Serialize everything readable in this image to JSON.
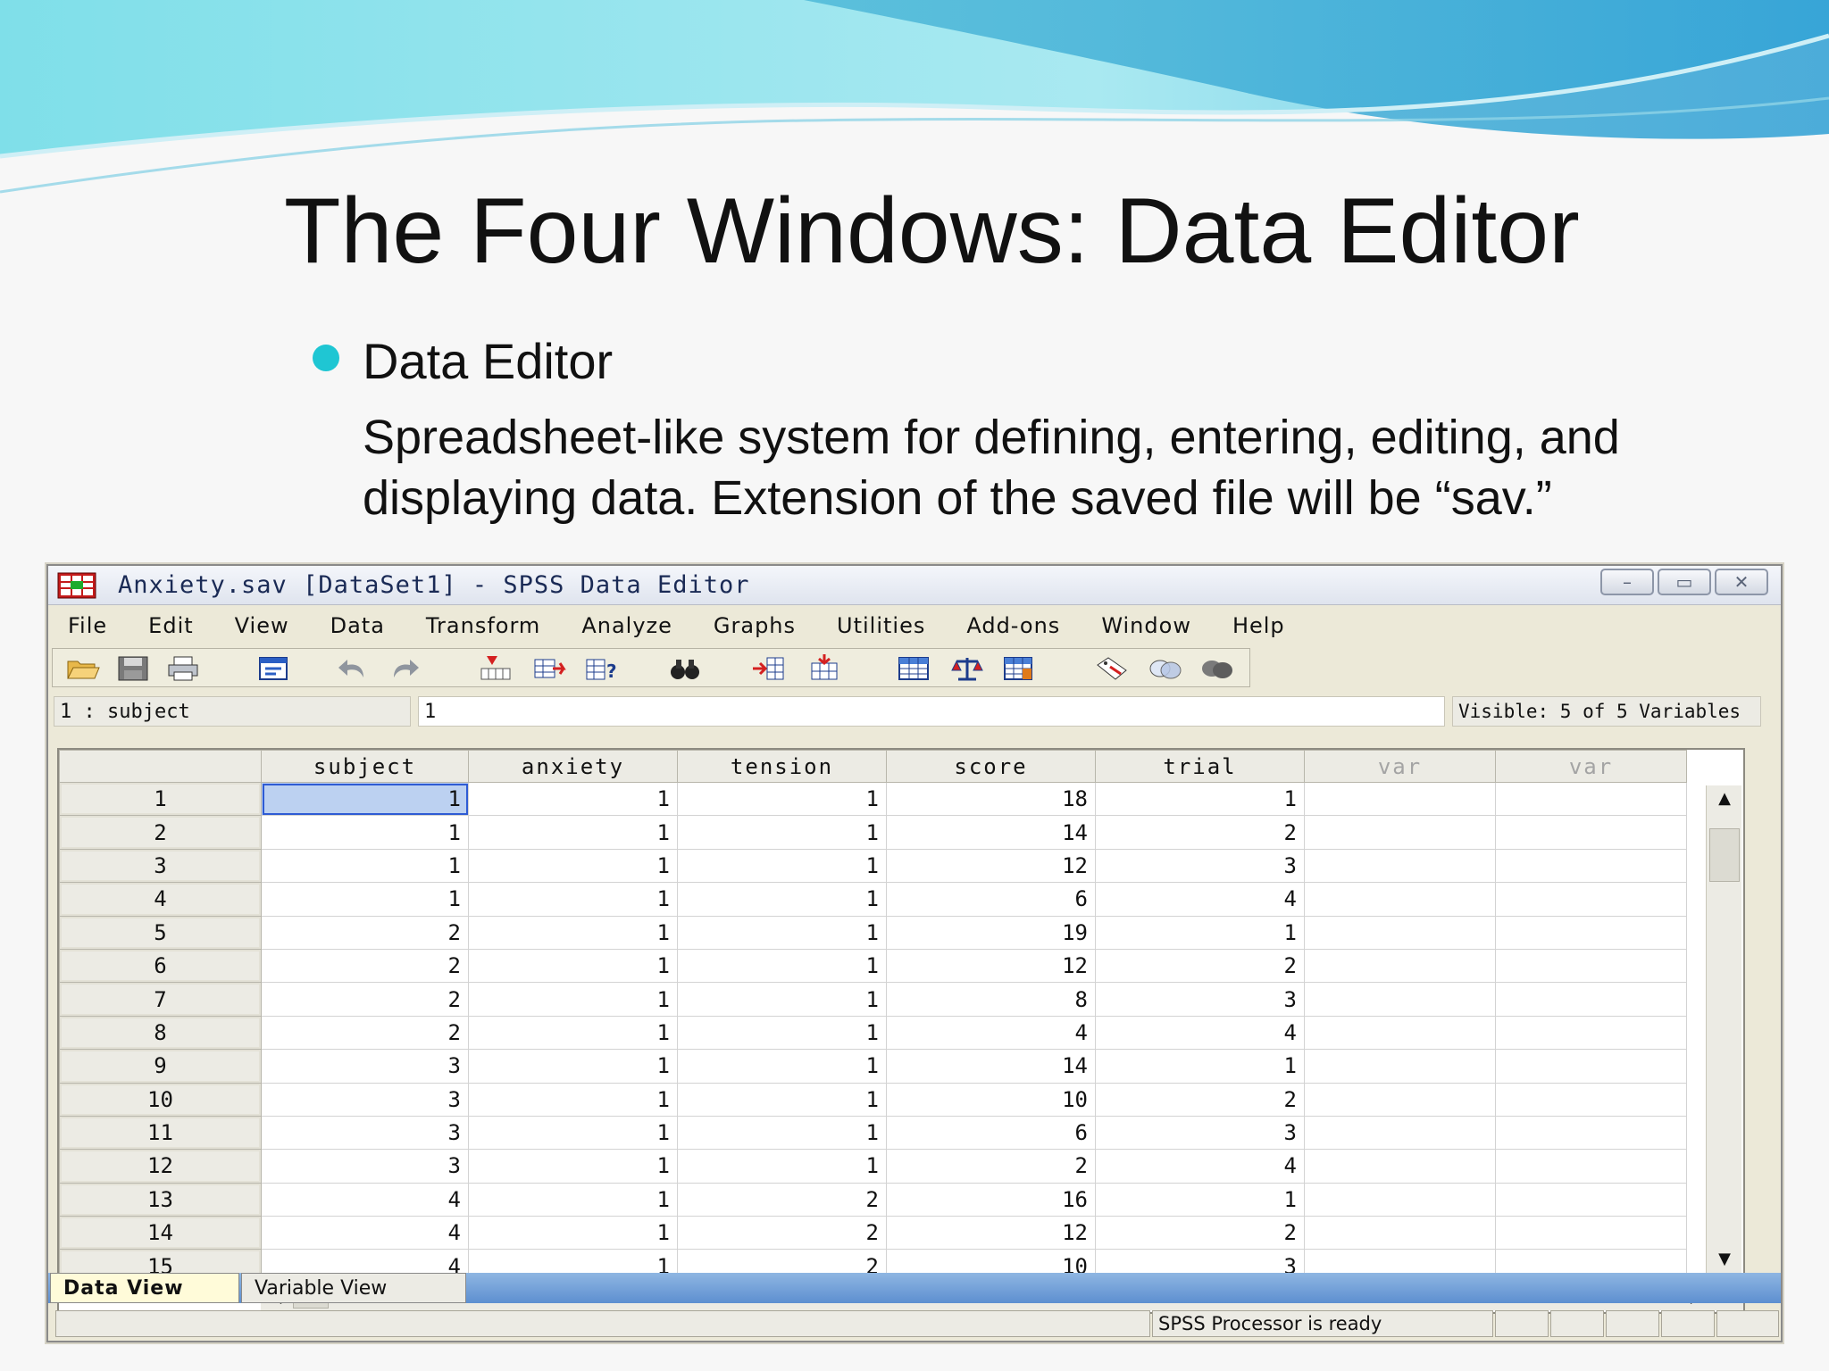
{
  "slide": {
    "title": "The Four Windows: Data Editor",
    "bullet_heading": "Data Editor",
    "bullet_body": "Spreadsheet-like system for defining, entering, editing, and displaying data. Extension of the saved file will be “sav.”"
  },
  "window": {
    "title": "Anxiety.sav [DataSet1] - SPSS Data Editor",
    "minimize": "–",
    "maximize": "▭",
    "close": "✕"
  },
  "menu": [
    "File",
    "Edit",
    "View",
    "Data",
    "Transform",
    "Analyze",
    "Graphs",
    "Utilities",
    "Add-ons",
    "Window",
    "Help"
  ],
  "toolbar_icons": [
    "open-icon",
    "save-icon",
    "print-icon",
    "dialog-recall-icon",
    "undo-icon",
    "redo-icon",
    "goto-case-icon",
    "goto-variable-icon",
    "variable-info-icon",
    "find-icon",
    "insert-case-icon",
    "insert-variable-icon",
    "split-file-icon",
    "weight-cases-icon",
    "select-cases-icon",
    "value-labels-icon",
    "use-sets-icon",
    "show-all-variables-icon"
  ],
  "cellbar": {
    "reference": "1 : subject",
    "value": "1",
    "visible": "Visible: 5 of 5 Variables"
  },
  "grid": {
    "columns": [
      "subject",
      "anxiety",
      "tension",
      "score",
      "trial",
      "var",
      "var"
    ],
    "rows": [
      {
        "n": "1",
        "cells": [
          "1",
          "1",
          "1",
          "18",
          "1"
        ]
      },
      {
        "n": "2",
        "cells": [
          "1",
          "1",
          "1",
          "14",
          "2"
        ]
      },
      {
        "n": "3",
        "cells": [
          "1",
          "1",
          "1",
          "12",
          "3"
        ]
      },
      {
        "n": "4",
        "cells": [
          "1",
          "1",
          "1",
          "6",
          "4"
        ]
      },
      {
        "n": "5",
        "cells": [
          "2",
          "1",
          "1",
          "19",
          "1"
        ]
      },
      {
        "n": "6",
        "cells": [
          "2",
          "1",
          "1",
          "12",
          "2"
        ]
      },
      {
        "n": "7",
        "cells": [
          "2",
          "1",
          "1",
          "8",
          "3"
        ]
      },
      {
        "n": "8",
        "cells": [
          "2",
          "1",
          "1",
          "4",
          "4"
        ]
      },
      {
        "n": "9",
        "cells": [
          "3",
          "1",
          "1",
          "14",
          "1"
        ]
      },
      {
        "n": "10",
        "cells": [
          "3",
          "1",
          "1",
          "10",
          "2"
        ]
      },
      {
        "n": "11",
        "cells": [
          "3",
          "1",
          "1",
          "6",
          "3"
        ]
      },
      {
        "n": "12",
        "cells": [
          "3",
          "1",
          "1",
          "2",
          "4"
        ]
      },
      {
        "n": "13",
        "cells": [
          "4",
          "1",
          "2",
          "16",
          "1"
        ]
      },
      {
        "n": "14",
        "cells": [
          "4",
          "1",
          "2",
          "12",
          "2"
        ]
      },
      {
        "n": "15",
        "cells": [
          "4",
          "1",
          "2",
          "10",
          "3"
        ]
      }
    ]
  },
  "tabs": {
    "data_view": "Data View",
    "variable_view": "Variable View"
  },
  "status": {
    "text": "SPSS  Processor is ready"
  }
}
